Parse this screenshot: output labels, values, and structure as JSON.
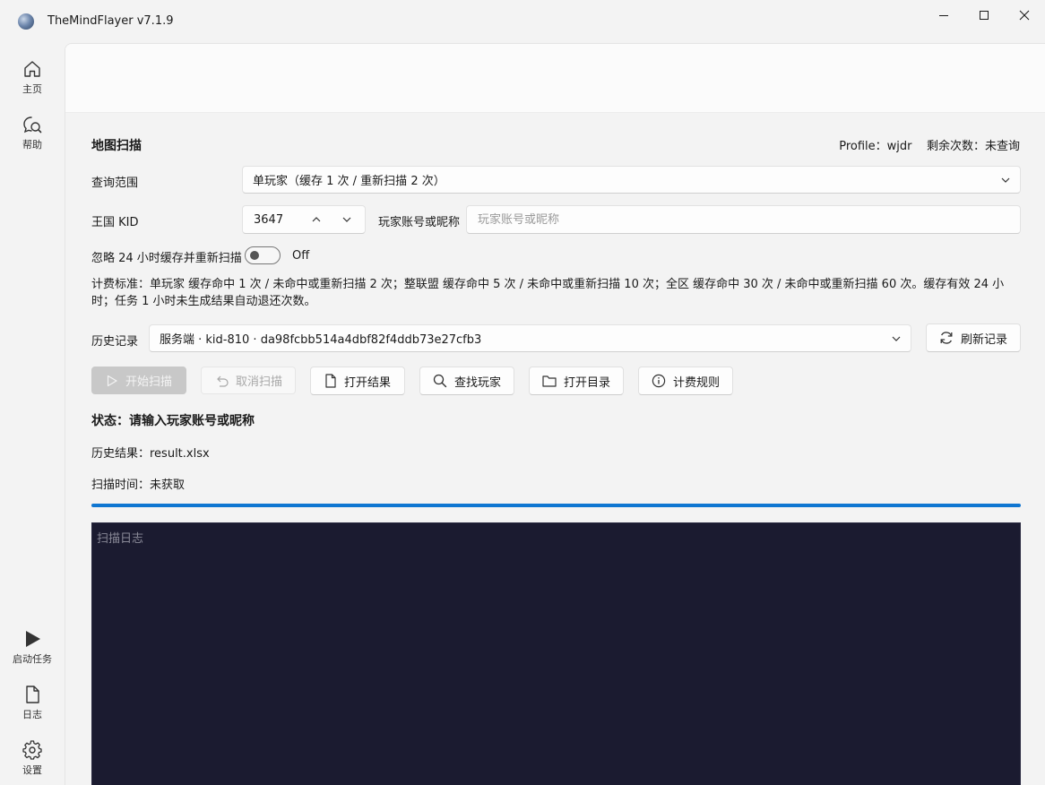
{
  "app": {
    "title": "TheMindFlayer v7.1.9"
  },
  "sidebar": {
    "top_items": [
      {
        "label": "主页",
        "icon": "home-icon"
      },
      {
        "label": "帮助",
        "icon": "help-icon"
      }
    ],
    "bottom_items": [
      {
        "label": "启动任务",
        "icon": "play-icon"
      },
      {
        "label": "日志",
        "icon": "document-icon"
      },
      {
        "label": "设置",
        "icon": "gear-icon"
      }
    ]
  },
  "scan": {
    "title": "地图扫描",
    "profile_info": "Profile：wjdr    剩余次数：未查询",
    "query_scope": {
      "label": "查询范围",
      "value": "单玩家（缓存 1 次 / 重新扫描 2 次）"
    },
    "kingdom": {
      "label": "王国 KID",
      "value": "3647"
    },
    "player": {
      "label": "玩家账号或昵称",
      "placeholder": "玩家账号或昵称",
      "value": ""
    },
    "ignore_cache": {
      "label": "忽略 24 小时缓存并重新扫描",
      "state": "Off"
    },
    "billing_text": "计费标准：单玩家 缓存命中 1 次 / 未命中或重新扫描 2 次；整联盟 缓存命中 5 次 / 未命中或重新扫描 10 次；全区 缓存命中 30 次 / 未命中或重新扫描 60 次。缓存有效 24 小时；任务 1 小时未生成结果自动退还次数。",
    "history": {
      "label": "历史记录",
      "value": "服务端 · kid-810 · da98fcbb514a4dbf82f4ddb73e27cfb3",
      "refresh_label": "刷新记录"
    },
    "actions": {
      "start": "开始扫描",
      "cancel": "取消扫描",
      "open_result": "打开结果",
      "find_player": "查找玩家",
      "open_dir": "打开目录",
      "billing_rules": "计费规则"
    },
    "status": "状态：请输入玩家账号或昵称",
    "history_result": "历史结果：result.xlsx",
    "scan_time": "扫描时间：未获取",
    "progress": 1.0,
    "log_placeholder": "扫描日志"
  },
  "colors": {
    "accent": "#0f76d1",
    "log_background": "#1b1b30"
  }
}
